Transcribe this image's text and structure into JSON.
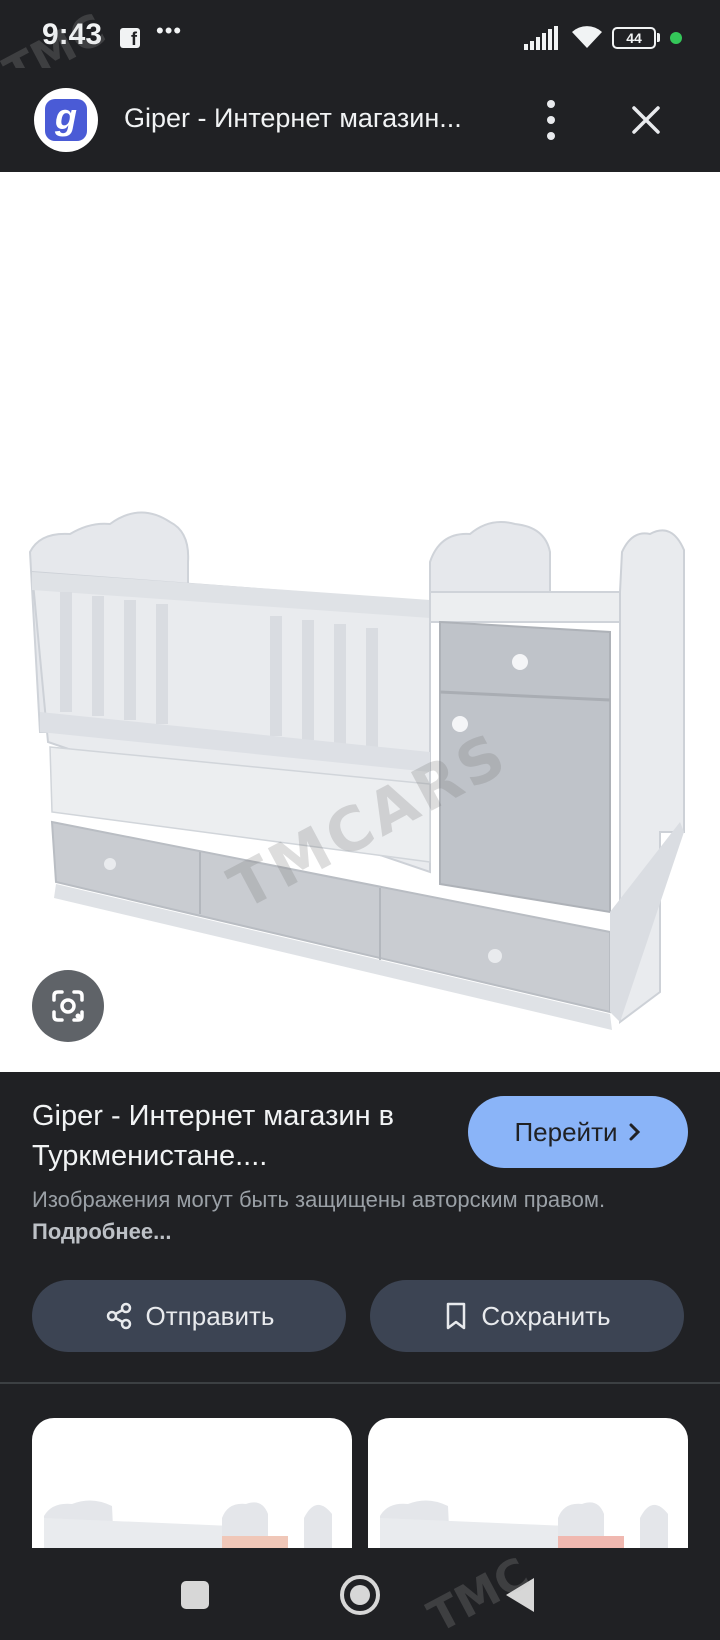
{
  "status_bar": {
    "time": "9:43",
    "battery": "44",
    "icons": [
      "facebook-icon",
      "more-dots-icon",
      "signal-icon",
      "wifi-icon",
      "battery-icon"
    ]
  },
  "header": {
    "logo_letter": "g",
    "title": "Giper - Интернет магазин..."
  },
  "image": {
    "watermark": "TMCARS",
    "lens_icon": "google-lens-icon"
  },
  "info": {
    "title": "Giper - Интернет магазин в Туркменистане....",
    "goto_label": "Перейти",
    "copyright_text": "Изображения могут быть защищены авторским правом.",
    "more_link": "Подробнее..."
  },
  "actions": {
    "share_label": "Отправить",
    "save_label": "Сохранить"
  },
  "watermarks": {
    "top": "TMC",
    "nav": "TMC"
  },
  "colors": {
    "background": "#202124",
    "accent_button": "#8ab4f8",
    "action_button": "#3c4453"
  }
}
